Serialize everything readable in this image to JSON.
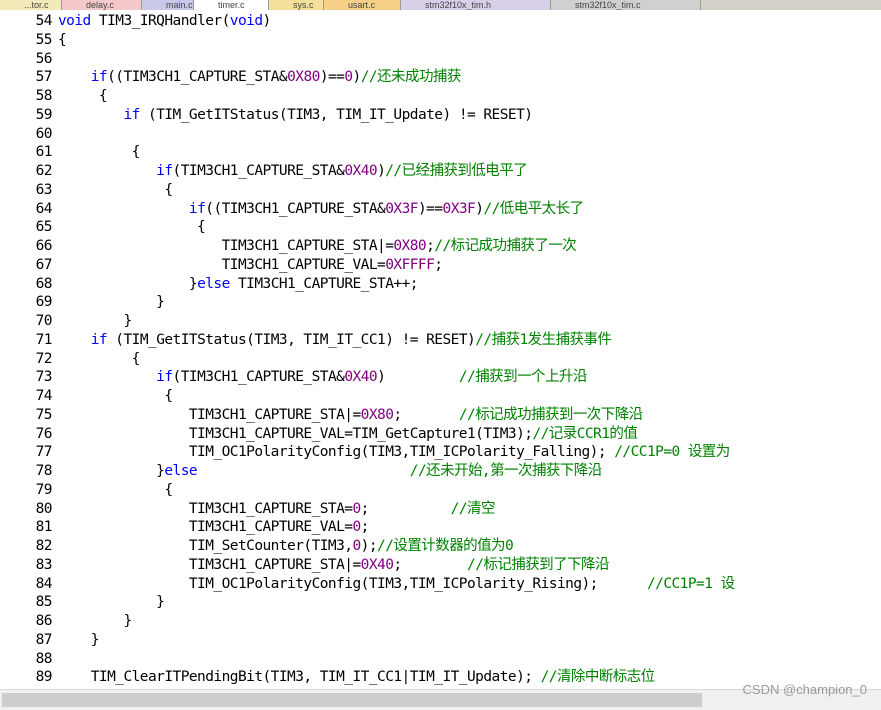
{
  "tabs": [
    {
      "label": "...tor.c",
      "color": "#f4e9b8"
    },
    {
      "label": "delay.c",
      "color": "#f5c9c9"
    },
    {
      "label": "main.c",
      "color": "#c8c8e8"
    },
    {
      "label": "timer.c",
      "color": "#ffffff"
    },
    {
      "label": "sys.c",
      "color": "#f4e09a"
    },
    {
      "label": "usart.c",
      "color": "#f6d089"
    },
    {
      "label": "stm32f10x_tim.h",
      "color": "#d8d0e8"
    },
    {
      "label": "stm32f10x_tim.c",
      "color": "#d0d0d0"
    }
  ],
  "code_lines": [
    {
      "n": "54",
      "segs": [
        {
          "t": "void",
          "c": "kw"
        },
        {
          "t": " TIM3_IRQHandler(",
          "c": ""
        },
        {
          "t": "void",
          "c": "kw"
        },
        {
          "t": ")",
          "c": ""
        }
      ]
    },
    {
      "n": "55",
      "segs": [
        {
          "t": "{",
          "c": ""
        }
      ]
    },
    {
      "n": "56",
      "segs": []
    },
    {
      "n": "57",
      "segs": [
        {
          "t": "    ",
          "c": ""
        },
        {
          "t": "if",
          "c": "kw"
        },
        {
          "t": "((TIM3CH1_CAPTURE_STA&",
          "c": ""
        },
        {
          "t": "0X80",
          "c": "num"
        },
        {
          "t": ")==",
          "c": ""
        },
        {
          "t": "0",
          "c": "num"
        },
        {
          "t": ")",
          "c": ""
        },
        {
          "t": "//还未成功捕获",
          "c": "cm"
        }
      ]
    },
    {
      "n": "58",
      "segs": [
        {
          "t": "     {",
          "c": ""
        }
      ]
    },
    {
      "n": "59",
      "segs": [
        {
          "t": "        ",
          "c": ""
        },
        {
          "t": "if",
          "c": "kw"
        },
        {
          "t": " (TIM_GetITStatus(TIM3, TIM_IT_Update) != RESET)",
          "c": ""
        }
      ]
    },
    {
      "n": "60",
      "segs": []
    },
    {
      "n": "61",
      "segs": [
        {
          "t": "         {",
          "c": ""
        }
      ]
    },
    {
      "n": "62",
      "segs": [
        {
          "t": "            ",
          "c": ""
        },
        {
          "t": "if",
          "c": "kw"
        },
        {
          "t": "(TIM3CH1_CAPTURE_STA&",
          "c": ""
        },
        {
          "t": "0X40",
          "c": "num"
        },
        {
          "t": ")",
          "c": ""
        },
        {
          "t": "//已经捕获到低电平了",
          "c": "cm"
        }
      ]
    },
    {
      "n": "63",
      "segs": [
        {
          "t": "             {",
          "c": ""
        }
      ]
    },
    {
      "n": "64",
      "segs": [
        {
          "t": "                ",
          "c": ""
        },
        {
          "t": "if",
          "c": "kw"
        },
        {
          "t": "((TIM3CH1_CAPTURE_STA&",
          "c": ""
        },
        {
          "t": "0X3F",
          "c": "num"
        },
        {
          "t": ")==",
          "c": ""
        },
        {
          "t": "0X3F",
          "c": "num"
        },
        {
          "t": ")",
          "c": ""
        },
        {
          "t": "//低电平太长了",
          "c": "cm"
        }
      ]
    },
    {
      "n": "65",
      "segs": [
        {
          "t": "                 {",
          "c": ""
        }
      ]
    },
    {
      "n": "66",
      "segs": [
        {
          "t": "                    TIM3CH1_CAPTURE_STA|=",
          "c": ""
        },
        {
          "t": "0X80",
          "c": "num"
        },
        {
          "t": ";",
          "c": ""
        },
        {
          "t": "//标记成功捕获了一次",
          "c": "cm"
        }
      ]
    },
    {
      "n": "67",
      "segs": [
        {
          "t": "                    TIM3CH1_CAPTURE_VAL=",
          "c": ""
        },
        {
          "t": "0XFFFF",
          "c": "num"
        },
        {
          "t": ";",
          "c": ""
        }
      ]
    },
    {
      "n": "68",
      "segs": [
        {
          "t": "                }",
          "c": ""
        },
        {
          "t": "else",
          "c": "kw"
        },
        {
          "t": " TIM3CH1_CAPTURE_STA++;",
          "c": ""
        }
      ]
    },
    {
      "n": "69",
      "segs": [
        {
          "t": "            }",
          "c": ""
        }
      ]
    },
    {
      "n": "70",
      "segs": [
        {
          "t": "        }",
          "c": ""
        }
      ]
    },
    {
      "n": "71",
      "segs": [
        {
          "t": "    ",
          "c": ""
        },
        {
          "t": "if",
          "c": "kw"
        },
        {
          "t": " (TIM_GetITStatus(TIM3, TIM_IT_CC1) != RESET)",
          "c": ""
        },
        {
          "t": "//捕获1发生捕获事件",
          "c": "cm"
        }
      ]
    },
    {
      "n": "72",
      "segs": [
        {
          "t": "         {",
          "c": ""
        }
      ]
    },
    {
      "n": "73",
      "segs": [
        {
          "t": "            ",
          "c": ""
        },
        {
          "t": "if",
          "c": "kw"
        },
        {
          "t": "(TIM3CH1_CAPTURE_STA&",
          "c": ""
        },
        {
          "t": "0X40",
          "c": "num"
        },
        {
          "t": ")         ",
          "c": ""
        },
        {
          "t": "//捕获到一个上升沿",
          "c": "cm"
        }
      ]
    },
    {
      "n": "74",
      "segs": [
        {
          "t": "             {",
          "c": ""
        }
      ]
    },
    {
      "n": "75",
      "segs": [
        {
          "t": "                TIM3CH1_CAPTURE_STA|=",
          "c": ""
        },
        {
          "t": "0X80",
          "c": "num"
        },
        {
          "t": ";       ",
          "c": ""
        },
        {
          "t": "//标记成功捕获到一次下降沿",
          "c": "cm"
        }
      ]
    },
    {
      "n": "76",
      "segs": [
        {
          "t": "                TIM3CH1_CAPTURE_VAL=TIM_GetCapture1(TIM3);",
          "c": ""
        },
        {
          "t": "//记录CCR1的值",
          "c": "cm"
        }
      ]
    },
    {
      "n": "77",
      "segs": [
        {
          "t": "                TIM_OC1PolarityConfig(TIM3,TIM_ICPolarity_Falling); ",
          "c": ""
        },
        {
          "t": "//CC1P=0 设置为",
          "c": "cm"
        }
      ]
    },
    {
      "n": "78",
      "segs": [
        {
          "t": "            }",
          "c": ""
        },
        {
          "t": "else",
          "c": "kw"
        },
        {
          "t": "                          ",
          "c": ""
        },
        {
          "t": "//还未开始,第一次捕获下降沿",
          "c": "cm"
        }
      ]
    },
    {
      "n": "79",
      "segs": [
        {
          "t": "             {",
          "c": ""
        }
      ]
    },
    {
      "n": "80",
      "segs": [
        {
          "t": "                TIM3CH1_CAPTURE_STA=",
          "c": ""
        },
        {
          "t": "0",
          "c": "num"
        },
        {
          "t": ";          ",
          "c": ""
        },
        {
          "t": "//清空",
          "c": "cm"
        }
      ]
    },
    {
      "n": "81",
      "segs": [
        {
          "t": "                TIM3CH1_CAPTURE_VAL=",
          "c": ""
        },
        {
          "t": "0",
          "c": "num"
        },
        {
          "t": ";",
          "c": ""
        }
      ]
    },
    {
      "n": "82",
      "segs": [
        {
          "t": "                TIM_SetCounter(TIM3,",
          "c": ""
        },
        {
          "t": "0",
          "c": "num"
        },
        {
          "t": ");",
          "c": ""
        },
        {
          "t": "//设置计数器的值为0",
          "c": "cm"
        }
      ]
    },
    {
      "n": "83",
      "segs": [
        {
          "t": "                TIM3CH1_CAPTURE_STA|=",
          "c": ""
        },
        {
          "t": "0X40",
          "c": "num"
        },
        {
          "t": ";        ",
          "c": ""
        },
        {
          "t": "//标记捕获到了下降沿",
          "c": "cm"
        }
      ]
    },
    {
      "n": "84",
      "segs": [
        {
          "t": "                TIM_OC1PolarityConfig(TIM3,TIM_ICPolarity_Rising);      ",
          "c": ""
        },
        {
          "t": "//CC1P=1 设",
          "c": "cm"
        }
      ]
    },
    {
      "n": "85",
      "segs": [
        {
          "t": "            }",
          "c": ""
        }
      ]
    },
    {
      "n": "86",
      "segs": [
        {
          "t": "        }",
          "c": ""
        }
      ]
    },
    {
      "n": "87",
      "segs": [
        {
          "t": "    }",
          "c": ""
        }
      ]
    },
    {
      "n": "88",
      "segs": []
    },
    {
      "n": "89",
      "segs": [
        {
          "t": "    TIM_ClearITPendingBit(TIM3, TIM_IT_CC1|TIM_IT_Update); ",
          "c": ""
        },
        {
          "t": "//清除中断标志位",
          "c": "cm"
        }
      ]
    }
  ],
  "watermark": "CSDN @champion_0"
}
